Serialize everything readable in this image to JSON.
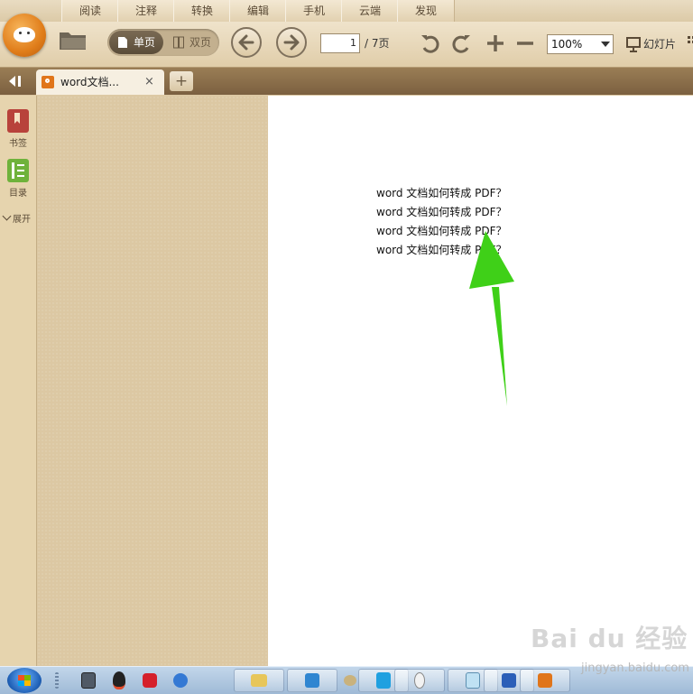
{
  "menu_tabs": [
    "阅读",
    "注释",
    "转换",
    "编辑",
    "手机",
    "云端",
    "发现"
  ],
  "toolbar": {
    "single_page_label": "单页",
    "double_page_label": "双页",
    "page_current": "1",
    "page_total": "/ 7页",
    "zoom": "100%",
    "slideshow_label": "幻灯片"
  },
  "doc_tab": {
    "title": "word文档...",
    "close_glyph": "×",
    "new_tab_glyph": "+"
  },
  "sidebar": {
    "bookmark_label": "书签",
    "toc_label": "目录",
    "expand_label": "展开"
  },
  "document": {
    "lines": [
      "word 文档如何转成 PDF？",
      "word 文档如何转成 PDF？",
      "word 文档如何转成 PDF？",
      "word 文档如何转成 PDF？"
    ],
    "annotation_color": "#3fd018"
  },
  "watermark": {
    "text": "Bai du 经验",
    "sub": "jingyan.baidu.com"
  },
  "colors": {
    "accent": "#e07d1a",
    "toolbar": "#e8d8b8",
    "panel": "#dcc8a3"
  }
}
